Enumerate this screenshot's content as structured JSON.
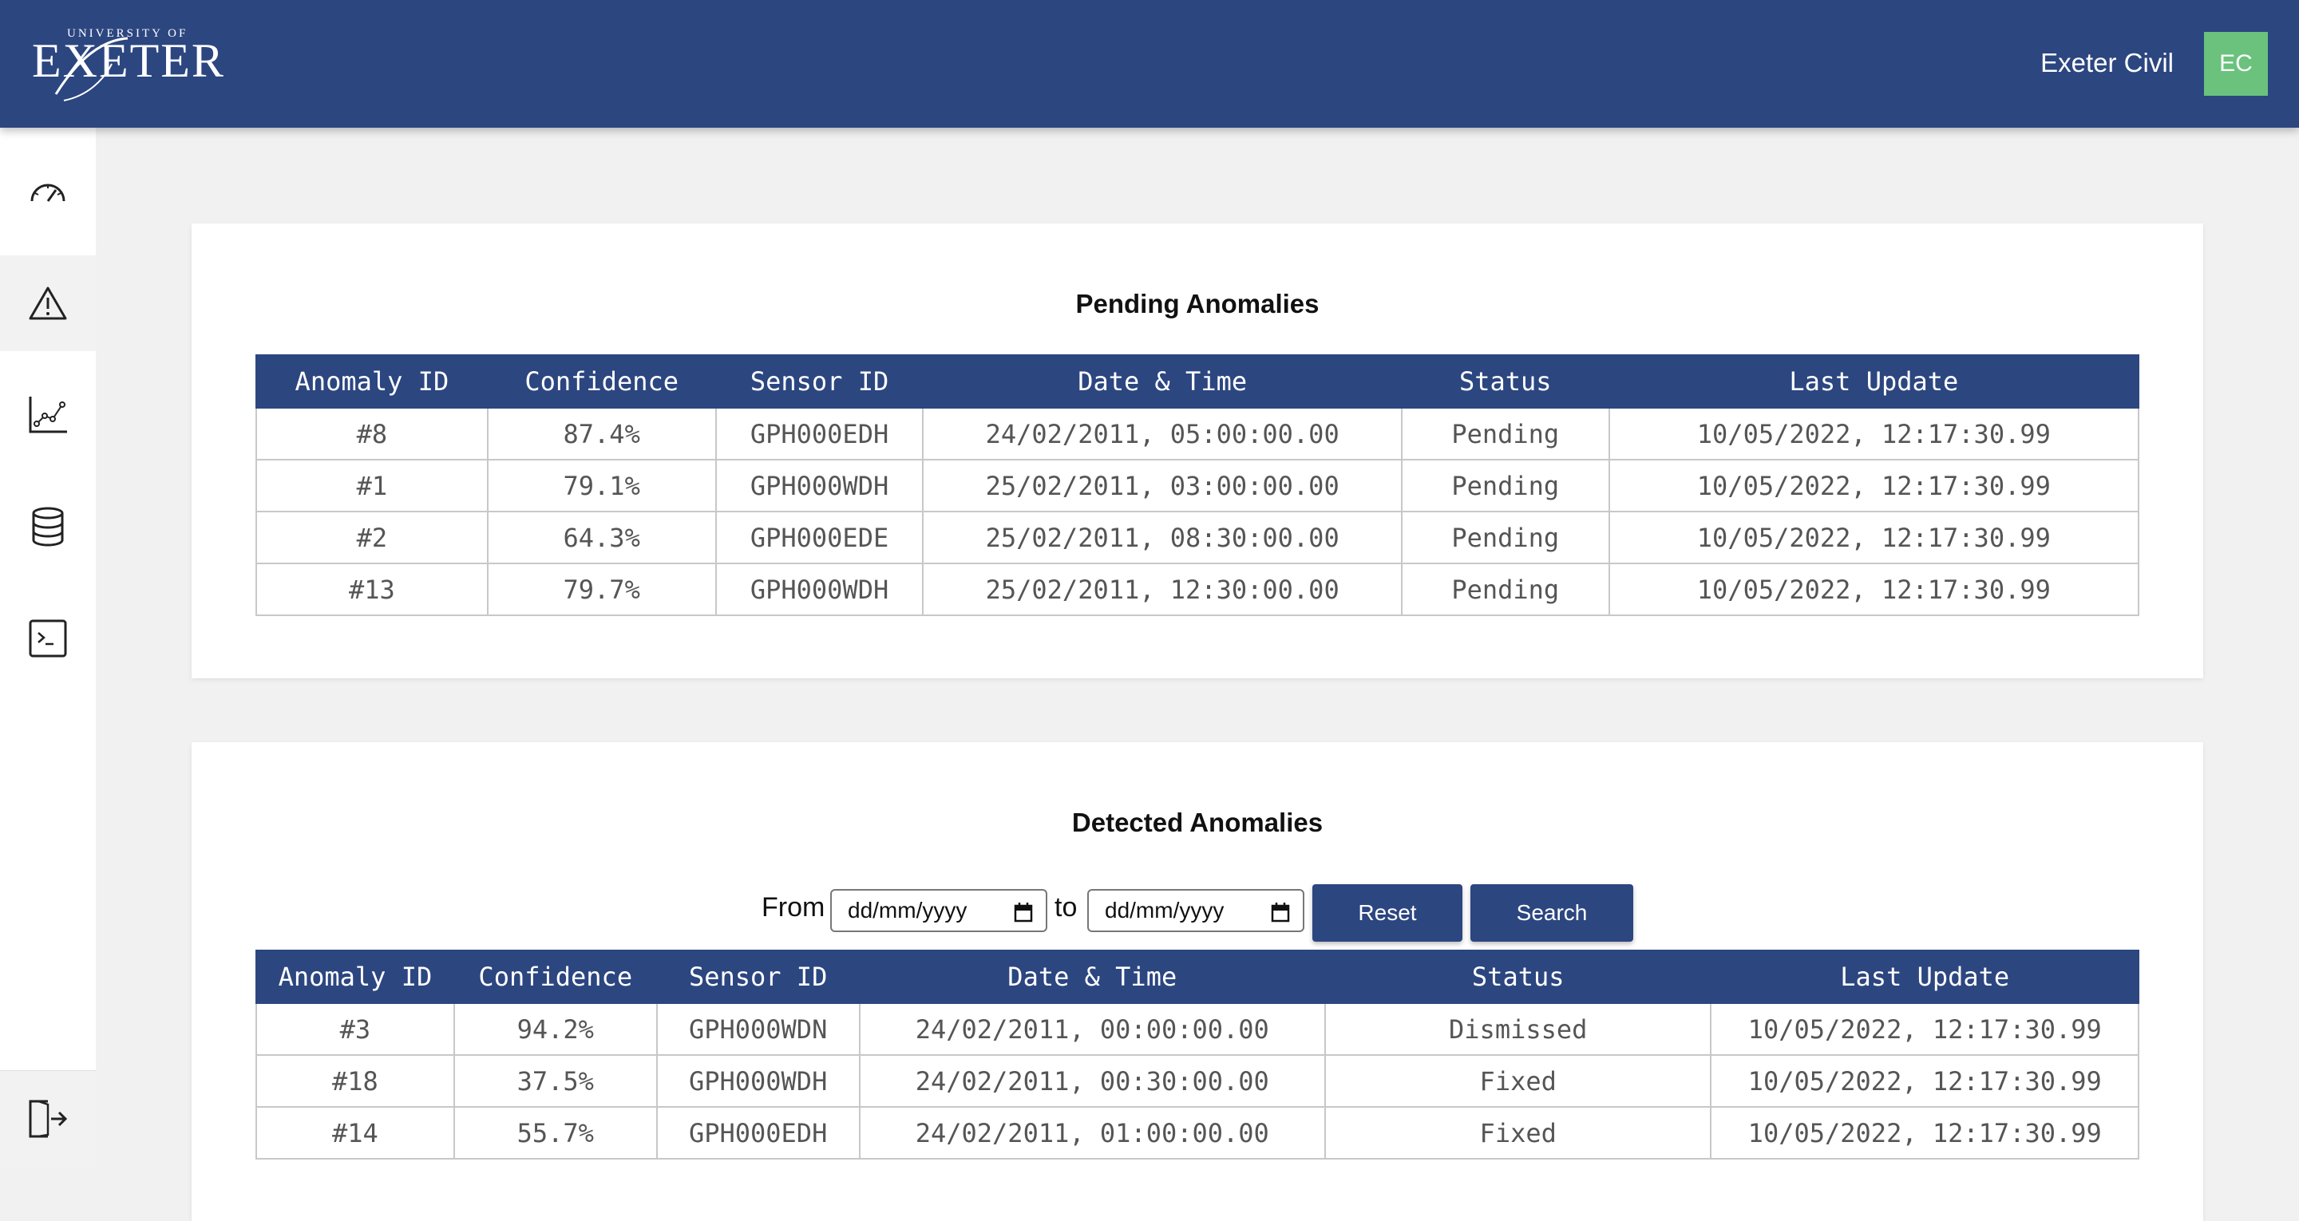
{
  "header": {
    "logo": {
      "small": "UNIVERSITY OF",
      "big": "EXETER"
    },
    "org_name": "Exeter Civil",
    "avatar_initials": "EC",
    "colors": {
      "primary": "#2c4680",
      "avatar": "#6ac27d"
    }
  },
  "sidebar": {
    "items": [
      {
        "icon": "gauge-icon",
        "active": false
      },
      {
        "icon": "warning-icon",
        "active": true
      },
      {
        "icon": "chart-icon",
        "active": false
      },
      {
        "icon": "database-icon",
        "active": false
      },
      {
        "icon": "terminal-icon",
        "active": false
      }
    ],
    "bottom": {
      "icon": "logout-icon"
    }
  },
  "pending": {
    "title": "Pending Anomalies",
    "columns": [
      "Anomaly ID",
      "Confidence",
      "Sensor ID",
      "Date & Time",
      "Status",
      "Last Update"
    ],
    "rows": [
      [
        "#8",
        "87.4%",
        "GPH000EDH",
        "24/02/2011, 05:00:00.00",
        "Pending",
        "10/05/2022, 12:17:30.99"
      ],
      [
        "#1",
        "79.1%",
        "GPH000WDH",
        "25/02/2011, 03:00:00.00",
        "Pending",
        "10/05/2022, 12:17:30.99"
      ],
      [
        "#2",
        "64.3%",
        "GPH000EDE",
        "25/02/2011, 08:30:00.00",
        "Pending",
        "10/05/2022, 12:17:30.99"
      ],
      [
        "#13",
        "79.7%",
        "GPH000WDH",
        "25/02/2011, 12:30:00.00",
        "Pending",
        "10/05/2022, 12:17:30.99"
      ]
    ]
  },
  "detected": {
    "title": "Detected Anomalies",
    "filters": {
      "from_label": "From",
      "to_label": "to",
      "from_placeholder": "dd/mm/yyyy",
      "to_placeholder": "dd/mm/yyyy",
      "reset_label": "Reset",
      "search_label": "Search"
    },
    "columns": [
      "Anomaly ID",
      "Confidence",
      "Sensor ID",
      "Date & Time",
      "Status",
      "Last Update"
    ],
    "rows": [
      [
        "#3",
        "94.2%",
        "GPH000WDN",
        "24/02/2011, 00:00:00.00",
        "Dismissed",
        "10/05/2022, 12:17:30.99"
      ],
      [
        "#18",
        "37.5%",
        "GPH000WDH",
        "24/02/2011, 00:30:00.00",
        "Fixed",
        "10/05/2022, 12:17:30.99"
      ],
      [
        "#14",
        "55.7%",
        "GPH000EDH",
        "24/02/2011, 01:00:00.00",
        "Fixed",
        "10/05/2022, 12:17:30.99"
      ]
    ]
  }
}
